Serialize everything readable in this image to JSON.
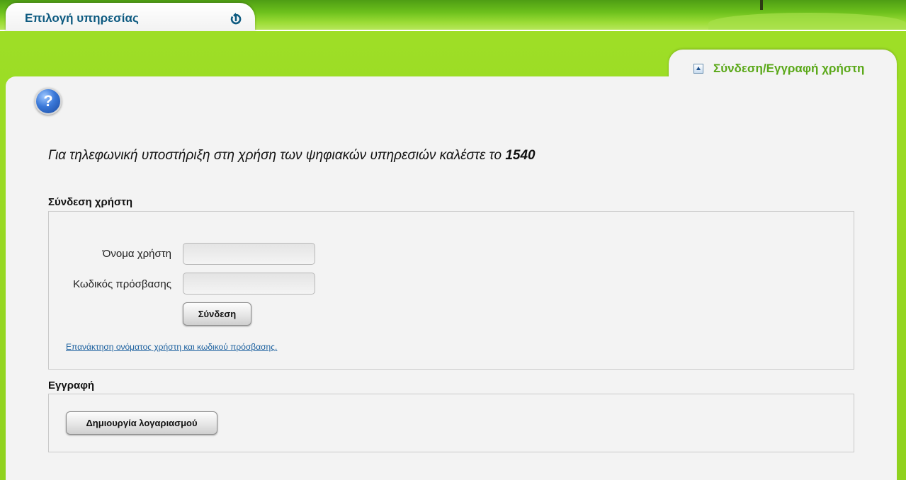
{
  "header": {
    "service_tab_title": "Επιλογή υπηρεσίας",
    "login_tab_label": "Σύνδεση/Εγγραφή χρήστη"
  },
  "icons": {
    "help": "help-icon",
    "service_toggle": "arrow-circle-icon",
    "login_tab": "collapse-up-icon"
  },
  "support": {
    "text": "Για τηλεφωνική υποστήριξη στη χρήση των ψηφιακών υπηρεσιών καλέστε το ",
    "number": "1540"
  },
  "login": {
    "section_title": "Σύνδεση χρήστη",
    "username_label": "Όνομα χρήστη",
    "username_value": "",
    "password_label": "Κωδικός πρόσβασης",
    "password_value": "",
    "submit_label": "Σύνδεση",
    "recover_link": "Επανάκτηση ονόματος χρήστη και κωδικού πρόσβασης."
  },
  "register": {
    "section_title": "Εγγραφή",
    "create_account_label": "Δημιουργία λογαριασμού"
  },
  "colors": {
    "accent_green": "#8fd420",
    "title_blue": "#0d5a80",
    "tab_label_green": "#5aa818",
    "link_blue": "#1a5f9e"
  }
}
